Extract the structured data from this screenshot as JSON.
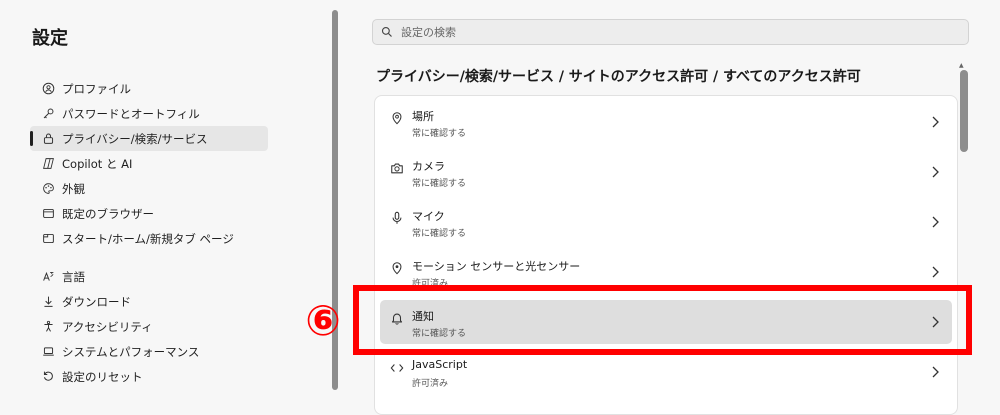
{
  "sidebar": {
    "title": "設定",
    "items": [
      {
        "label": "プロファイル",
        "icon": "profile-icon"
      },
      {
        "label": "パスワードとオートフィル",
        "icon": "key-icon"
      },
      {
        "label": "プライバシー/検索/サービス",
        "icon": "lock-icon",
        "active": true
      },
      {
        "label": "Copilot と AI",
        "icon": "copilot-icon"
      },
      {
        "label": "外観",
        "icon": "palette-icon"
      },
      {
        "label": "既定のブラウザー",
        "icon": "browser-icon"
      },
      {
        "label": "スタート/ホーム/新規タブ ページ",
        "icon": "home-tab-icon"
      },
      {
        "label": "言語",
        "icon": "language-icon"
      },
      {
        "label": "ダウンロード",
        "icon": "download-icon"
      },
      {
        "label": "アクセシビリティ",
        "icon": "accessibility-icon"
      },
      {
        "label": "システムとパフォーマンス",
        "icon": "laptop-icon"
      },
      {
        "label": "設定のリセット",
        "icon": "reset-icon"
      }
    ]
  },
  "search": {
    "placeholder": "設定の検索",
    "icon": "search-icon"
  },
  "breadcrumb": "プライバシー/検索/サービス / サイトのアクセス許可 / すべてのアクセス許可",
  "permissions": [
    {
      "title": "場所",
      "status": "常に確認する",
      "icon": "location-icon"
    },
    {
      "title": "カメラ",
      "status": "常に確認する",
      "icon": "camera-icon"
    },
    {
      "title": "マイク",
      "status": "常に確認する",
      "icon": "microphone-icon"
    },
    {
      "title": "モーション センサーと光センサー",
      "status": "許可済み",
      "icon": "sensor-icon"
    },
    {
      "title": "通知",
      "status": "常に確認する",
      "icon": "bell-icon",
      "highlighted": true
    },
    {
      "title": "JavaScript",
      "status": "許可済み",
      "icon": "code-icon"
    }
  ],
  "annotation": {
    "number": "⑥",
    "color": "#ff0000"
  },
  "colors": {
    "accent": "#ff0000",
    "sidebar_bg": "#f7f7f7",
    "card_bg": "#ffffff",
    "hover_bg": "#dedede"
  }
}
